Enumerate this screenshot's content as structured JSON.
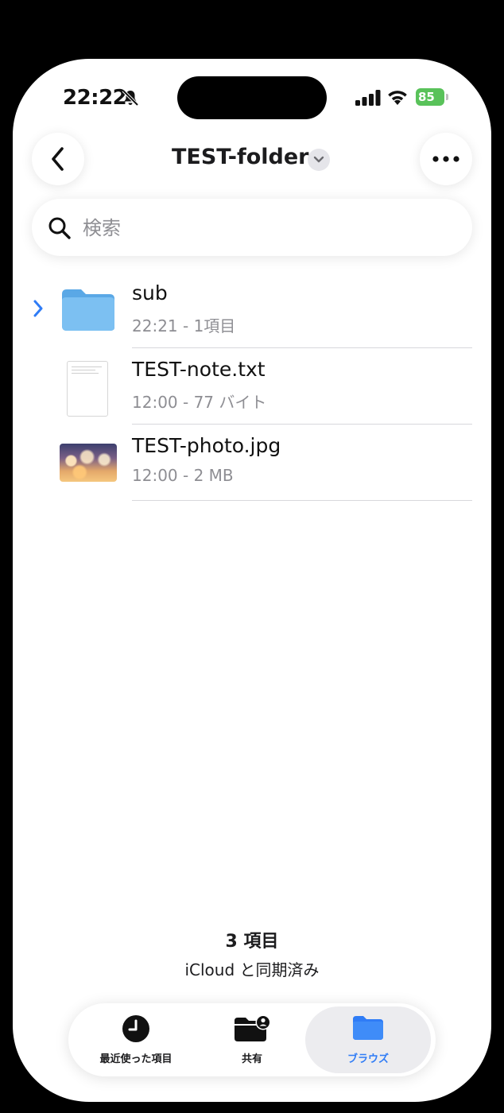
{
  "status_bar": {
    "time": "22:22",
    "battery": "85"
  },
  "nav": {
    "title": "TEST-folder"
  },
  "search": {
    "placeholder": "検索"
  },
  "files": [
    {
      "name": "sub",
      "meta": "22:21 - 1項目",
      "icon": "folder-icon"
    },
    {
      "name": "TEST-note.txt",
      "meta": "12:00 - 77 バイト",
      "icon": "text-document-icon"
    },
    {
      "name": "TEST-photo.jpg",
      "meta": "12:00 - 2 MB",
      "icon": "photo-thumbnail"
    }
  ],
  "footer": {
    "count": "3 項目",
    "sync": "iCloud と同期済み"
  },
  "tabs": [
    {
      "label": "最近使った項目",
      "icon": "clock-icon"
    },
    {
      "label": "共有",
      "icon": "shared-folder-icon"
    },
    {
      "label": "ブラウズ",
      "icon": "folder-icon",
      "active": true
    }
  ],
  "colors": {
    "accent": "#2f7cf6",
    "folder": "#6cb5ee",
    "battery": "#59c25a",
    "secondary_text": "#8e8e93"
  }
}
